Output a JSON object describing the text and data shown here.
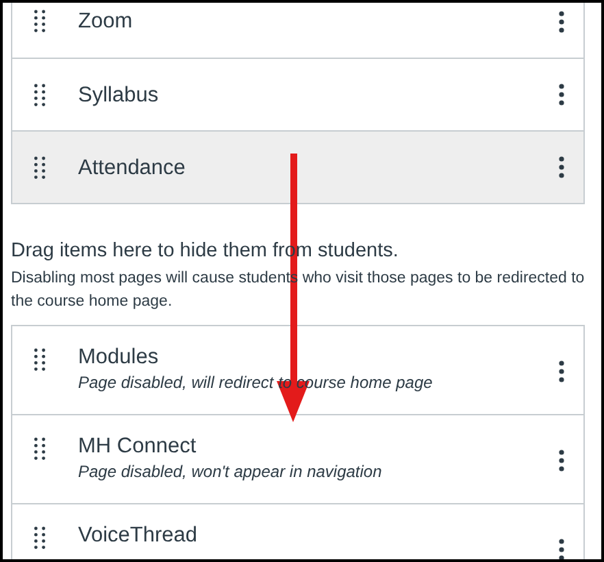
{
  "enabled_items": [
    {
      "label": "Zoom",
      "highlighted": false
    },
    {
      "label": "Syllabus",
      "highlighted": false
    },
    {
      "label": "Attendance",
      "highlighted": true
    }
  ],
  "hidden_section": {
    "heading": "Drag items here to hide them from students.",
    "note": "Disabling most pages will cause students who visit those pages to be redirected to the course home page."
  },
  "disabled_items": [
    {
      "label": "Modules",
      "status": "Page disabled, will redirect to course home page"
    },
    {
      "label": "MH Connect",
      "status": "Page disabled, won't appear in navigation"
    },
    {
      "label": "VoiceThread"
    }
  ]
}
